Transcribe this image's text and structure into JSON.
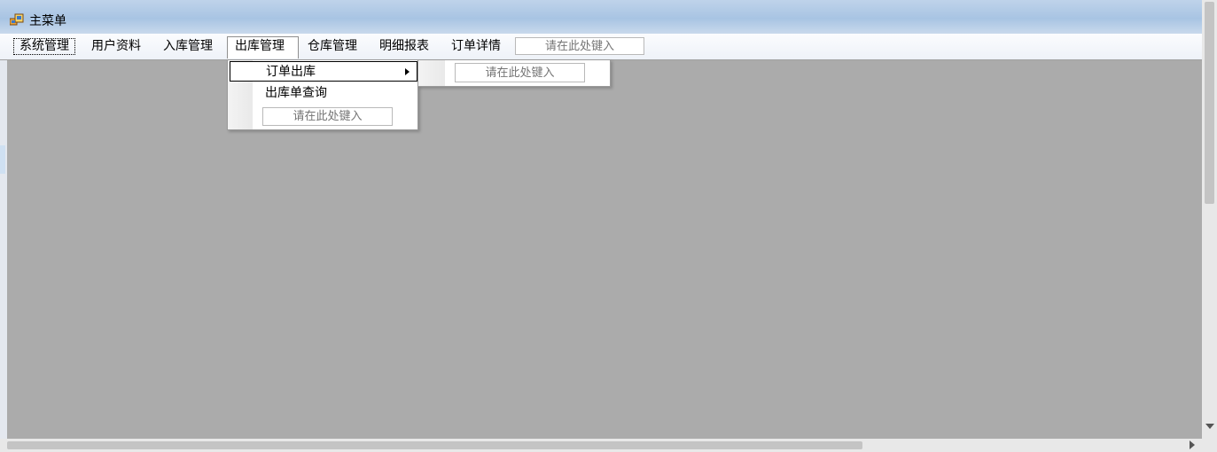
{
  "window": {
    "title": "主菜单",
    "icon": "app-window-icon"
  },
  "menubar": {
    "items": [
      {
        "label": "系统管理"
      },
      {
        "label": "用户资料"
      },
      {
        "label": "入库管理"
      },
      {
        "label": "出库管理"
      },
      {
        "label": "仓库管理"
      },
      {
        "label": "明细报表"
      },
      {
        "label": "订单详情"
      }
    ],
    "textbox_placeholder": "请在此处键入"
  },
  "dropdown": {
    "items": [
      {
        "label": "订单出库"
      },
      {
        "label": "出库单查询"
      }
    ],
    "textbox_placeholder": "请在此处键入"
  },
  "submenu": {
    "textbox_placeholder": "请在此处键入"
  }
}
